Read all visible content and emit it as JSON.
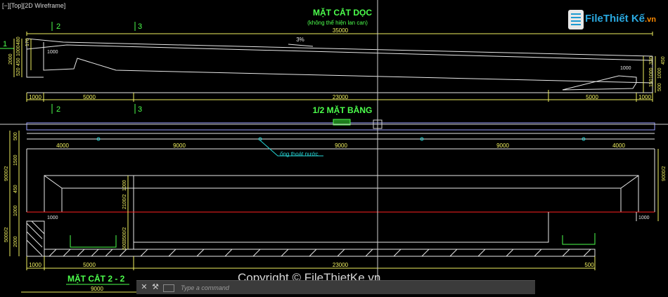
{
  "viewport": {
    "label": "[−][Top][2D Wireframe]"
  },
  "logo": {
    "part1": "File",
    "part2": "Thiết Kế",
    ".vn": ".vn",
    "suffix": ".vn"
  },
  "section1": {
    "title": "MẶT CẮT DỌC",
    "subtitle": "(không thể hiện lan can)",
    "total": "35000",
    "slope": "3%",
    "marks": [
      "2",
      "3",
      "1"
    ],
    "left_dims": [
      "2000",
      "520",
      "450",
      "1000",
      "480",
      "170",
      "1000"
    ],
    "right_dims": [
      "1000",
      "450",
      "330",
      "1000",
      "150",
      "500",
      "1000"
    ],
    "bottom_dims": [
      "1000",
      "5000",
      "23000",
      "5000",
      "1000"
    ]
  },
  "section2": {
    "title": "1/2 MẶT BẰNG",
    "marks": [
      "2",
      "3"
    ],
    "top_dims": [
      "4000",
      "9000",
      "9000",
      "9000",
      "4000"
    ],
    "drain_label": "ống thoát nước",
    "left_dims": [
      "500",
      "1500",
      "9000/2",
      "450",
      "1000",
      "5000/2",
      "2000"
    ],
    "right_dims": [
      "9000/2",
      "1000"
    ],
    "inner_dims": [
      "1000",
      "2100/2",
      "3500/2",
      "1000",
      "500"
    ],
    "bottom_dims": [
      "1000",
      "5000",
      "23000",
      "500"
    ]
  },
  "section3": {
    "title": "MẶT CẮT 2 - 2",
    "dim": "9000"
  },
  "command": {
    "placeholder": "Type a command",
    "close": "✕",
    "wrench": "⚒"
  },
  "watermark": {
    "text": "Copyright © FileThietKe.vn"
  },
  "colors": {
    "green": "#4cff4c",
    "dim": "#f0f060",
    "line": "#e8e8e8",
    "cyan": "#26d6d6",
    "red": "#ff2020",
    "cross": "#cfcfcf"
  }
}
